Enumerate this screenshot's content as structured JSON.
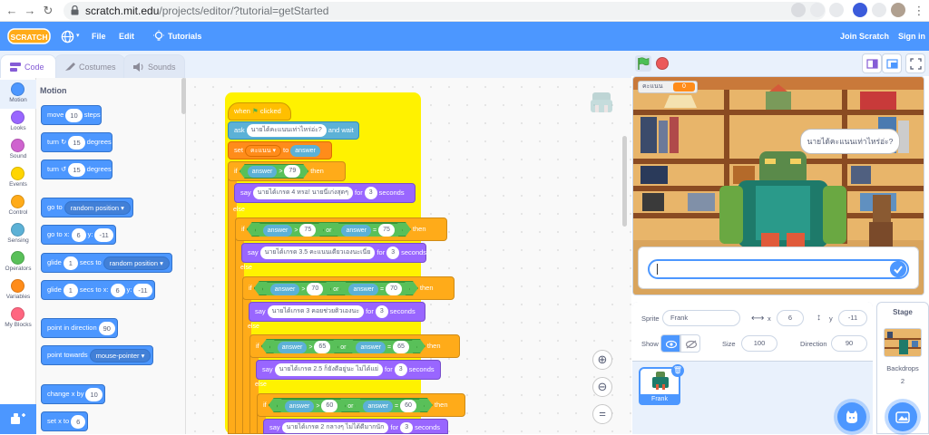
{
  "browser": {
    "url_host": "scratch.mit.edu",
    "url_path": "/projects/editor/?tutorial=getStarted"
  },
  "menu": {
    "file": "File",
    "edit": "Edit",
    "tutorials": "Tutorials",
    "join": "Join Scratch",
    "signin": "Sign in",
    "logo_text": "SCRATCH"
  },
  "tabs": {
    "code": "Code",
    "costumes": "Costumes",
    "sounds": "Sounds"
  },
  "categories": [
    {
      "label": "Motion",
      "color": "#4c97ff"
    },
    {
      "label": "Looks",
      "color": "#9966ff"
    },
    {
      "label": "Sound",
      "color": "#cf63cf"
    },
    {
      "label": "Events",
      "color": "#ffd500"
    },
    {
      "label": "Control",
      "color": "#ffab19"
    },
    {
      "label": "Sensing",
      "color": "#5cb1d6"
    },
    {
      "label": "Operators",
      "color": "#59c059"
    },
    {
      "label": "Variables",
      "color": "#ff8c1a"
    },
    {
      "label": "My Blocks",
      "color": "#ff6680"
    }
  ],
  "palette": {
    "title": "Motion",
    "move": {
      "pre": "move",
      "val": "10",
      "post": "steps"
    },
    "turn_r": {
      "pre": "turn",
      "val": "15",
      "post": "degrees"
    },
    "turn_l": {
      "pre": "turn",
      "val": "15",
      "post": "degrees"
    },
    "goto": {
      "pre": "go to",
      "dd": "random position"
    },
    "gotoxy": {
      "pre": "go to x:",
      "x": "6",
      "ylabel": "y:",
      "y": "-11"
    },
    "glide1": {
      "pre": "glide",
      "val": "1",
      "mid": "secs to",
      "dd": "random position"
    },
    "glide2": {
      "pre": "glide",
      "val": "1",
      "mid": "secs to x:",
      "x": "6",
      "ylabel": "y:",
      "y": "-11"
    },
    "point_dir": {
      "pre": "point in direction",
      "val": "90"
    },
    "point_towards": {
      "pre": "point towards",
      "dd": "mouse-pointer"
    },
    "change_x": {
      "pre": "change x by",
      "val": "10"
    },
    "set_x": {
      "pre": "set x to",
      "val": "6"
    }
  },
  "script": {
    "hat": {
      "pre": "when",
      "post": "clicked"
    },
    "ask": {
      "pre": "ask",
      "val": "นายได้คะแนนเท่าไหร่อ่ะ?",
      "post": "and wait"
    },
    "set": {
      "pre": "set",
      "var": "คะแนน",
      "mid": "to",
      "val": "answer"
    },
    "if1": {
      "kw": "if",
      "a": "answer",
      "op": ">",
      "b": "79",
      "then": "then"
    },
    "say1": {
      "pre": "say",
      "msg": "นายได้เกรด 4 หรอ! นายนี่เก่งสุดๆ",
      "for": "for",
      "secs": "3",
      "post": "seconds"
    },
    "else": "else",
    "if2": {
      "kw": "if",
      "a": "answer",
      "op": ">",
      "b": "75",
      "or": "or",
      "c": "answer",
      "eq": "=",
      "d": "75",
      "then": "then"
    },
    "say2": {
      "pre": "say",
      "msg": "นายได้เกรด 3.5 คะแนนเดียวเองนะเนี่ย",
      "for": "for",
      "secs": "3",
      "post": "seconds"
    },
    "if3": {
      "kw": "if",
      "a": "answer",
      "op": ">",
      "b": "70",
      "or": "or",
      "c": "answer",
      "eq": "=",
      "d": "70",
      "then": "then"
    },
    "say3": {
      "pre": "say",
      "msg": "นายได้เกรด 3 คอยช่วยติวเองนะ",
      "for": "for",
      "secs": "3",
      "post": "seconds"
    },
    "if4": {
      "kw": "if",
      "a": "answer",
      "op": ">",
      "b": "65",
      "or": "or",
      "c": "answer",
      "eq": "=",
      "d": "65",
      "then": "then"
    },
    "say4": {
      "pre": "say",
      "msg": "นายได้เกรด 2.5 ก็ยังดีอยู่นะ ไม่ได้แย่",
      "for": "for",
      "secs": "3",
      "post": "seconds"
    },
    "if5": {
      "kw": "if",
      "a": "answer",
      "op": ">",
      "b": "60",
      "or": "or",
      "c": "answer",
      "eq": "=",
      "d": "60",
      "then": "then"
    },
    "say5": {
      "pre": "say",
      "msg": "นายได้เกรด 2 กลางๆ ไม่ได้ดีมากนัก",
      "for": "for",
      "secs": "3",
      "post": "seconds"
    }
  },
  "stage": {
    "monitor_label": "คะแนน",
    "monitor_value": "0",
    "bubble": "นายได้คะแนนเท่าไหร่อ่ะ?"
  },
  "sprite_info": {
    "sprite_label": "Sprite",
    "name": "Frank",
    "x_label": "x",
    "x": "6",
    "y_label": "y",
    "y": "-11",
    "show_label": "Show",
    "size_label": "Size",
    "size": "100",
    "direction_label": "Direction",
    "direction": "90"
  },
  "sprite_list": {
    "thumb_name": "Frank"
  },
  "stage_pane": {
    "title": "Stage",
    "backdrops_label": "Backdrops",
    "backdrops_count": "2"
  }
}
